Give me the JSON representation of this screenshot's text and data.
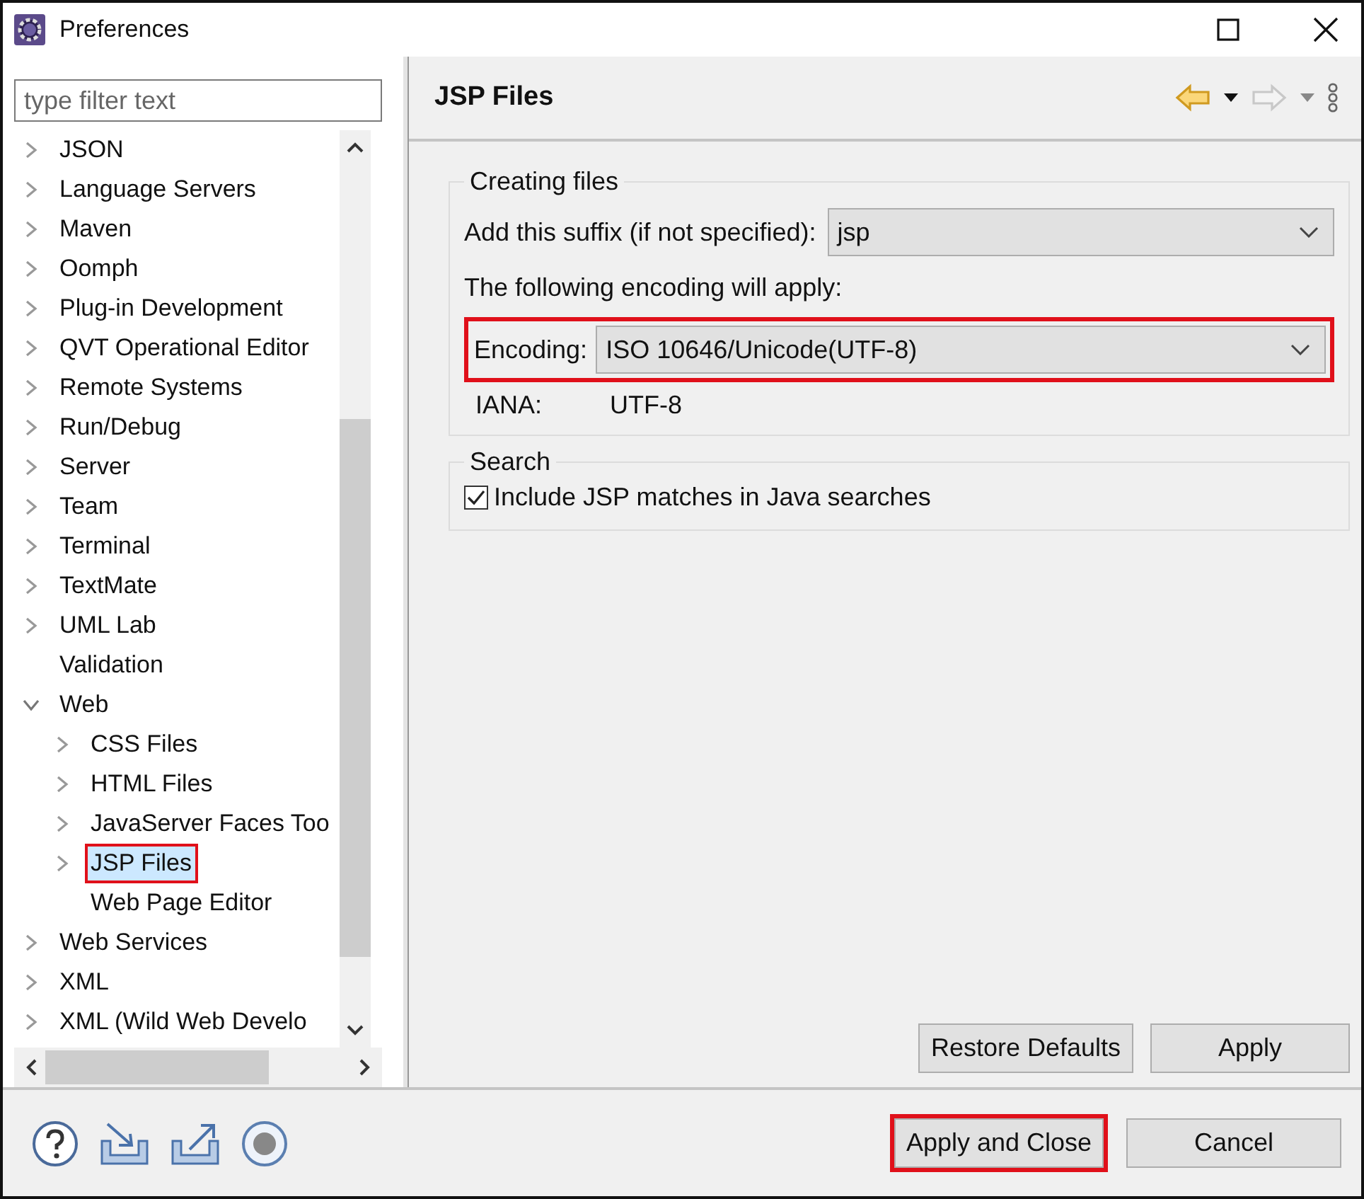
{
  "window": {
    "title": "Preferences"
  },
  "sidebar": {
    "filter": {
      "placeholder": "type filter text"
    },
    "tree": [
      {
        "label": "JSON",
        "expanded": false,
        "selected": false,
        "highlighted": false
      },
      {
        "label": "Language Servers",
        "expanded": false,
        "selected": false,
        "highlighted": false
      },
      {
        "label": "Maven",
        "expanded": false,
        "selected": false,
        "highlighted": false
      },
      {
        "label": "Oomph",
        "expanded": false,
        "selected": false,
        "highlighted": false
      },
      {
        "label": "Plug-in Development",
        "expanded": false,
        "selected": false,
        "highlighted": false
      },
      {
        "label": "QVT Operational Editor",
        "expanded": false,
        "selected": false,
        "highlighted": false
      },
      {
        "label": "Remote Systems",
        "expanded": false,
        "selected": false,
        "highlighted": false
      },
      {
        "label": "Run/Debug",
        "expanded": false,
        "selected": false,
        "highlighted": false
      },
      {
        "label": "Server",
        "expanded": false,
        "selected": false,
        "highlighted": false
      },
      {
        "label": "Team",
        "expanded": false,
        "selected": false,
        "highlighted": false
      },
      {
        "label": "Terminal",
        "expanded": false,
        "selected": false,
        "highlighted": false
      },
      {
        "label": "TextMate",
        "expanded": false,
        "selected": false,
        "highlighted": false
      },
      {
        "label": "UML Lab",
        "expanded": false,
        "selected": false,
        "highlighted": false
      },
      {
        "label": "Validation",
        "selected": false,
        "highlighted": false
      },
      {
        "label": "Web",
        "expanded": true,
        "selected": false,
        "highlighted": false,
        "children": [
          {
            "label": "CSS Files",
            "expanded": false,
            "selected": false,
            "highlighted": false
          },
          {
            "label": "HTML Files",
            "expanded": false,
            "selected": false,
            "highlighted": false
          },
          {
            "label": "JavaServer Faces Too",
            "expanded": false,
            "selected": false,
            "highlighted": false
          },
          {
            "label": "JSP Files",
            "expanded": false,
            "selected": true,
            "highlighted": true
          },
          {
            "label": "Web Page Editor",
            "selected": false,
            "highlighted": false
          }
        ]
      },
      {
        "label": "Web Services",
        "expanded": false,
        "selected": false,
        "highlighted": false
      },
      {
        "label": "XML",
        "expanded": false,
        "selected": false,
        "highlighted": false
      },
      {
        "label": "XML (Wild Web Develo",
        "expanded": false,
        "selected": false,
        "highlighted": false
      }
    ]
  },
  "page": {
    "title": "JSP Files",
    "nav": {
      "back_enabled": true,
      "forward_enabled": false
    },
    "creating_files": {
      "title": "Creating files",
      "suffix_label": "Add this suffix (if not specified):",
      "suffix_value": "jsp",
      "encoding_note": "The following encoding will apply:",
      "encoding_label": "Encoding:",
      "encoding_value": "ISO 10646/Unicode(UTF-8)",
      "encoding_highlighted": true,
      "iana_label": "IANA:",
      "iana_value": "UTF-8"
    },
    "search": {
      "title": "Search",
      "checkbox": {
        "label": "Include JSP matches in Java searches",
        "checked": true
      }
    },
    "buttons": [
      {
        "label": "Restore Defaults",
        "highlighted": false
      },
      {
        "label": "Apply",
        "highlighted": false
      }
    ]
  },
  "footer": {
    "buttons": [
      {
        "label": "Apply and Close",
        "highlighted": true
      },
      {
        "label": "Cancel",
        "highlighted": false
      }
    ]
  }
}
